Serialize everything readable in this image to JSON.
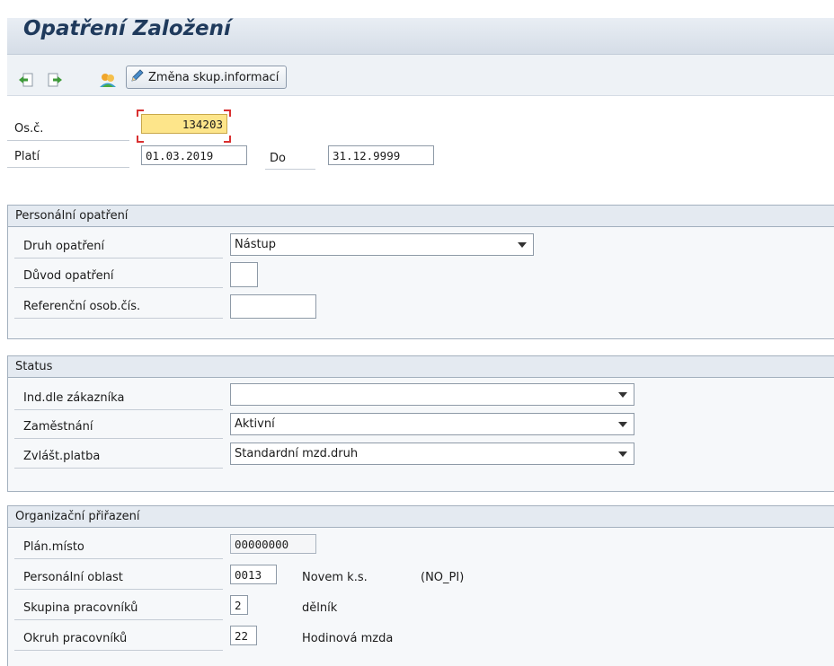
{
  "title": "Opatření Založení",
  "toolbar": {
    "icons": [
      "back-arrow-icon",
      "forward-arrow-icon",
      "overview-icon",
      "pencil-icon"
    ],
    "change_button_label": "Změna skup.informací"
  },
  "header": {
    "pernr_label": "Os.č.",
    "pernr_value": "134203",
    "valid_label": "Platí",
    "valid_from": "01.03.2019",
    "to_label": "Do",
    "valid_to": "31.12.9999"
  },
  "personnel_action": {
    "title": "Personální opatření",
    "action_type_label": "Druh opatření",
    "action_type_value": "Nástup",
    "reason_label": "Důvod opatření",
    "reason_value": "",
    "ref_pernr_label": "Referenční osob.čís.",
    "ref_pernr_value": ""
  },
  "status": {
    "title": "Status",
    "customer_label": "Ind.dle zákazníka",
    "customer_value": "",
    "employment_label": "Zaměstnání",
    "employment_value": "Aktivní",
    "special_payment_label": "Zvlášt.platba",
    "special_payment_value": "Standardní mzd.druh"
  },
  "org_assignment": {
    "title": "Organizační přiřazení",
    "position_label": "Plán.místo",
    "position_value": "00000000",
    "pers_area_label": "Personální oblast",
    "pers_area_value": "0013",
    "pers_area_text": "Novem k.s.",
    "pers_area_code": "(NO_PI)",
    "ee_group_label": "Skupina pracovníků",
    "ee_group_value": "2",
    "ee_group_text": "dělník",
    "ee_subgroup_label": "Okruh pracovníků",
    "ee_subgroup_value": "22",
    "ee_subgroup_text": "Hodinová mzda"
  },
  "colors": {
    "title_text": "#1f3a5c",
    "focus_field": "#fde58a",
    "focus_marker": "#d93030",
    "group_header": "#e4eaf1"
  }
}
